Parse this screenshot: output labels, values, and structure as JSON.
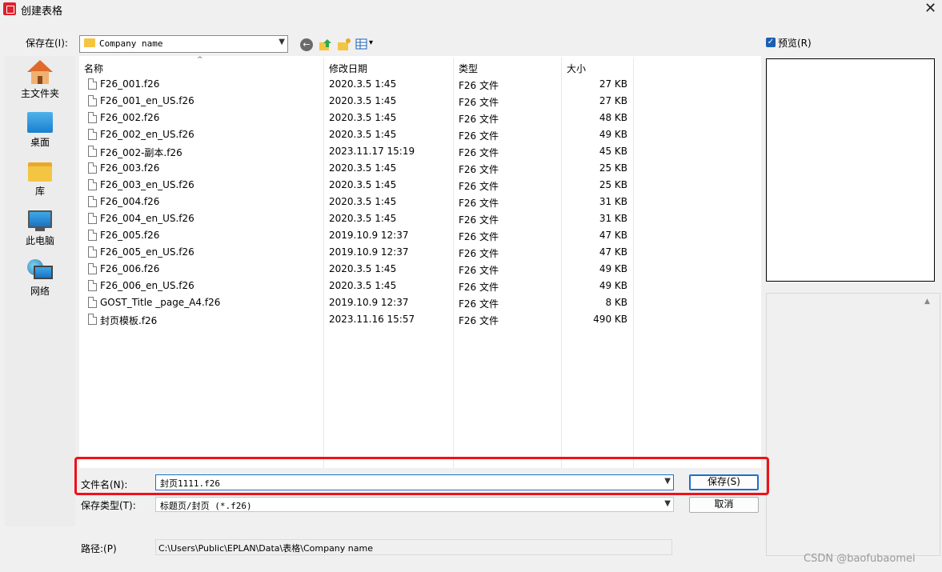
{
  "window": {
    "title": "创建表格",
    "close_glyph": "✕"
  },
  "toolbar": {
    "savein_label": "保存在(I):",
    "folder_value": "Company name",
    "back_glyph": "←",
    "view_arrow": "▾"
  },
  "preview": {
    "label": "预览(R)",
    "checked": true
  },
  "places": [
    {
      "label": "主文件夹",
      "icon": "home-icon"
    },
    {
      "label": "桌面",
      "icon": "desktop-icon"
    },
    {
      "label": "库",
      "icon": "library-icon"
    },
    {
      "label": "此电脑",
      "icon": "this-pc-icon"
    },
    {
      "label": "网络",
      "icon": "network-icon"
    }
  ],
  "columns": {
    "name": "名称",
    "date": "修改日期",
    "type": "类型",
    "size": "大小"
  },
  "files": [
    {
      "name": "F26_001.f26",
      "date": "2020.3.5 1:45",
      "type": "F26 文件",
      "size": "27 KB"
    },
    {
      "name": "F26_001_en_US.f26",
      "date": "2020.3.5 1:45",
      "type": "F26 文件",
      "size": "27 KB"
    },
    {
      "name": "F26_002.f26",
      "date": "2020.3.5 1:45",
      "type": "F26 文件",
      "size": "48 KB"
    },
    {
      "name": "F26_002_en_US.f26",
      "date": "2020.3.5 1:45",
      "type": "F26 文件",
      "size": "49 KB"
    },
    {
      "name": "F26_002-副本.f26",
      "date": "2023.11.17 15:19",
      "type": "F26 文件",
      "size": "45 KB"
    },
    {
      "name": "F26_003.f26",
      "date": "2020.3.5 1:45",
      "type": "F26 文件",
      "size": "25 KB"
    },
    {
      "name": "F26_003_en_US.f26",
      "date": "2020.3.5 1:45",
      "type": "F26 文件",
      "size": "25 KB"
    },
    {
      "name": "F26_004.f26",
      "date": "2020.3.5 1:45",
      "type": "F26 文件",
      "size": "31 KB"
    },
    {
      "name": "F26_004_en_US.f26",
      "date": "2020.3.5 1:45",
      "type": "F26 文件",
      "size": "31 KB"
    },
    {
      "name": "F26_005.f26",
      "date": "2019.10.9 12:37",
      "type": "F26 文件",
      "size": "47 KB"
    },
    {
      "name": "F26_005_en_US.f26",
      "date": "2019.10.9 12:37",
      "type": "F26 文件",
      "size": "47 KB"
    },
    {
      "name": "F26_006.f26",
      "date": "2020.3.5 1:45",
      "type": "F26 文件",
      "size": "49 KB"
    },
    {
      "name": "F26_006_en_US.f26",
      "date": "2020.3.5 1:45",
      "type": "F26 文件",
      "size": "49 KB"
    },
    {
      "name": "GOST_Title _page_A4.f26",
      "date": "2019.10.9 12:37",
      "type": "F26 文件",
      "size": "8 KB"
    },
    {
      "name": "封页模板.f26",
      "date": "2023.11.16 15:57",
      "type": "F26 文件",
      "size": "490 KB"
    }
  ],
  "filename": {
    "label": "文件名(N):",
    "value": "封页1111.f26"
  },
  "filetype": {
    "label": "保存类型(T):",
    "value": "标题页/封页 (*.f26)"
  },
  "buttons": {
    "save": "保存(S)",
    "cancel": "取消"
  },
  "path": {
    "label": "路径:(P)",
    "value": "C:\\Users\\Public\\EPLAN\\Data\\表格\\Company name"
  },
  "watermark": "CSDN @baofubaomei",
  "colors": {
    "highlight": "#f0101a",
    "accent": "#1a6fd0"
  }
}
